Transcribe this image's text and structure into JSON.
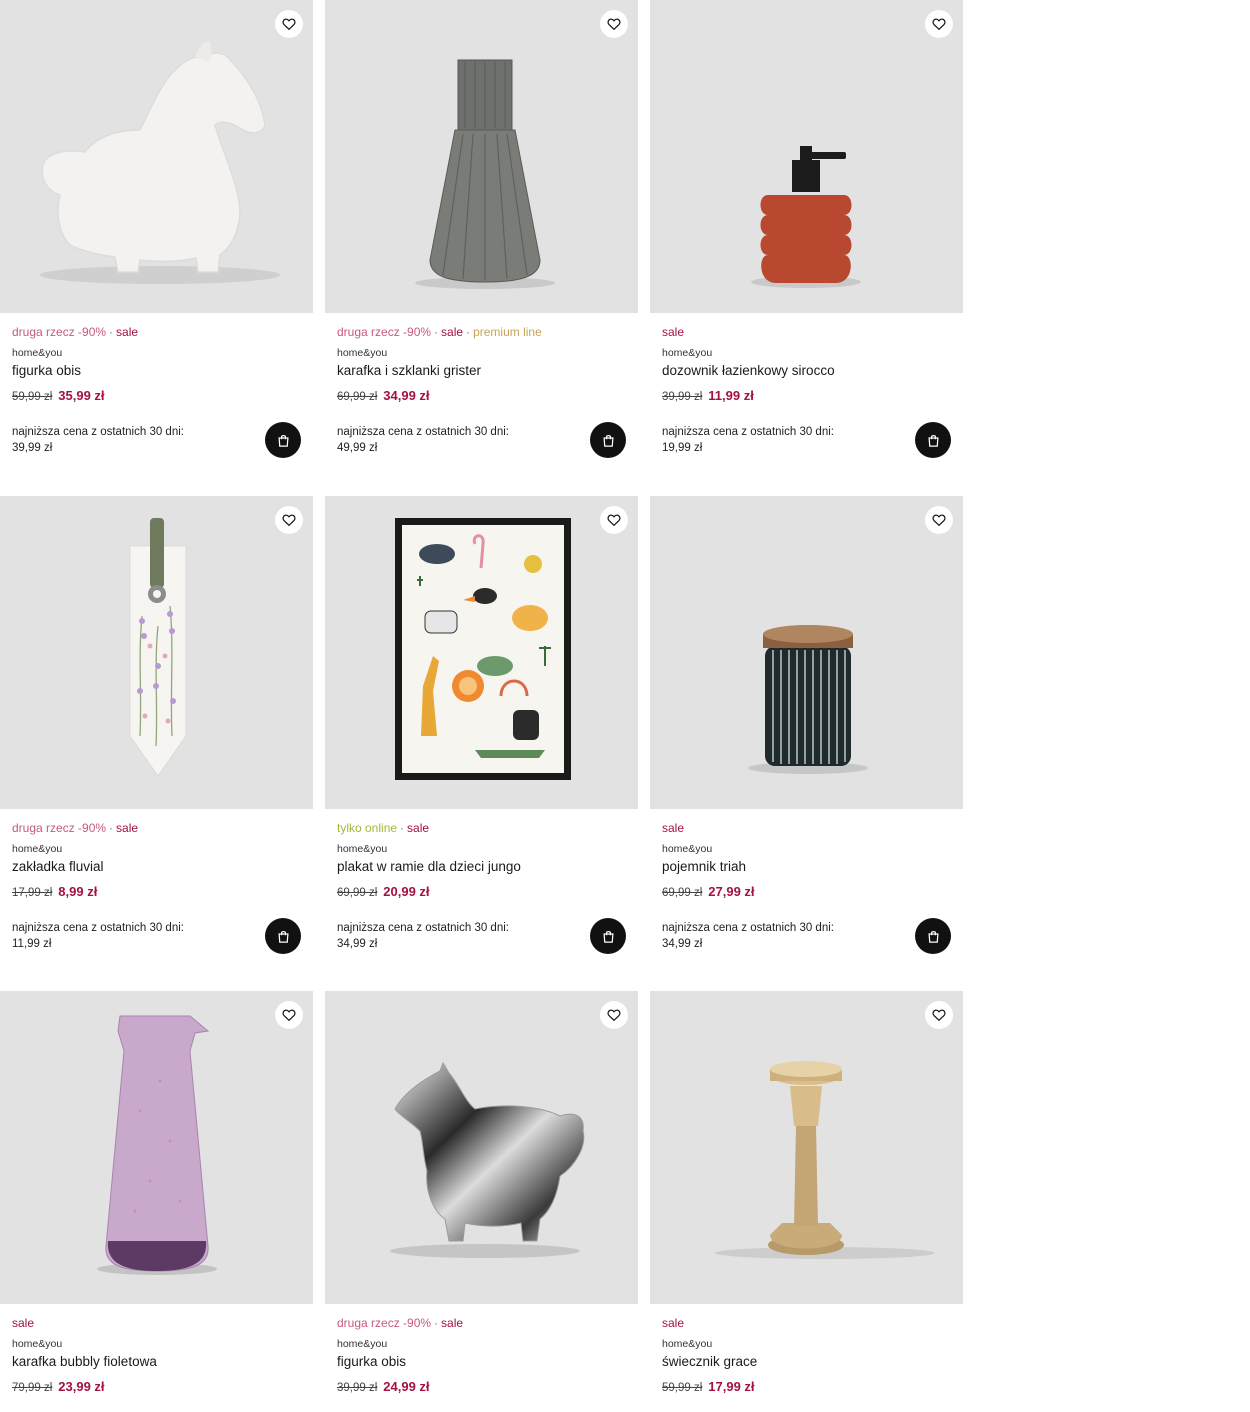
{
  "products": [
    {
      "badges": [
        {
          "text": "druga rzecz -90%",
          "type": "promo"
        },
        {
          "text": "sale",
          "type": "sale"
        }
      ],
      "brand": "home&you",
      "name": "figurka obis",
      "old_price": "59,99 zł",
      "new_price": "35,99 zł",
      "lowest_label": "najniższa cena z ostatnich 30 dni:",
      "lowest_value": "39,99 zł",
      "image": "white-ceramic-horse"
    },
    {
      "badges": [
        {
          "text": "druga rzecz -90%",
          "type": "promo"
        },
        {
          "text": "sale",
          "type": "sale"
        },
        {
          "text": "premium line",
          "type": "premium"
        }
      ],
      "brand": "home&you",
      "name": "karafka i szklanki grister",
      "old_price": "69,99 zł",
      "new_price": "34,99 zł",
      "lowest_label": "najniższa cena z ostatnich 30 dni:",
      "lowest_value": "49,99 zł",
      "image": "grey-glass-carafe"
    },
    {
      "badges": [
        {
          "text": "sale",
          "type": "sale"
        }
      ],
      "brand": "home&you",
      "name": "dozownik łazienkowy sirocco",
      "old_price": "39,99 zł",
      "new_price": "11,99 zł",
      "lowest_label": "najniższa cena z ostatnich 30 dni:",
      "lowest_value": "19,99 zł",
      "image": "terracotta-soap-dispenser"
    },
    {
      "badges": [
        {
          "text": "druga rzecz -90%",
          "type": "promo"
        },
        {
          "text": "sale",
          "type": "sale"
        }
      ],
      "brand": "home&you",
      "name": "zakładka fluvial",
      "old_price": "17,99 zł",
      "new_price": "8,99 zł",
      "lowest_label": "najniższa cena z ostatnich 30 dni:",
      "lowest_value": "11,99 zł",
      "image": "floral-bookmark"
    },
    {
      "badges": [
        {
          "text": "tylko online",
          "type": "online"
        },
        {
          "text": "sale",
          "type": "sale"
        }
      ],
      "brand": "home&you",
      "name": "plakat w ramie dla dzieci jungo",
      "old_price": "69,99 zł",
      "new_price": "20,99 zł",
      "lowest_label": "najniższa cena z ostatnich 30 dni:",
      "lowest_value": "34,99 zł",
      "image": "framed-animal-poster"
    },
    {
      "badges": [
        {
          "text": "sale",
          "type": "sale"
        }
      ],
      "brand": "home&you",
      "name": "pojemnik triah",
      "old_price": "69,99 zł",
      "new_price": "27,99 zł",
      "lowest_label": "najniższa cena z ostatnich 30 dni:",
      "lowest_value": "34,99 zł",
      "image": "striped-jar-with-wood-lid"
    },
    {
      "badges": [
        {
          "text": "sale",
          "type": "sale"
        }
      ],
      "brand": "home&you",
      "name": "karafka bubbly fioletowa",
      "old_price": "79,99 zł",
      "new_price": "23,99 zł",
      "lowest_label": "",
      "lowest_value": "",
      "image": "purple-glass-carafe"
    },
    {
      "badges": [
        {
          "text": "druga rzecz -90%",
          "type": "promo"
        },
        {
          "text": "sale",
          "type": "sale"
        }
      ],
      "brand": "home&you",
      "name": "figurka obis",
      "old_price": "39,99 zł",
      "new_price": "24,99 zł",
      "lowest_label": "",
      "lowest_value": "",
      "image": "chrome-horse-figurine"
    },
    {
      "badges": [
        {
          "text": "sale",
          "type": "sale"
        }
      ],
      "brand": "home&you",
      "name": "świecznik grace",
      "old_price": "59,99 zł",
      "new_price": "17,99 zł",
      "lowest_label": "",
      "lowest_value": "",
      "image": "gold-candle-holder"
    }
  ],
  "icons": {
    "favorite": "heart-icon",
    "cart": "shopping-bag-icon"
  },
  "colors": {
    "sale": "#a3123e",
    "promo": "#c75a7a",
    "premium": "#c9a35b",
    "online": "#a9b63c",
    "photo_bg": "#e2e2e2",
    "cart_bg": "#111111"
  }
}
